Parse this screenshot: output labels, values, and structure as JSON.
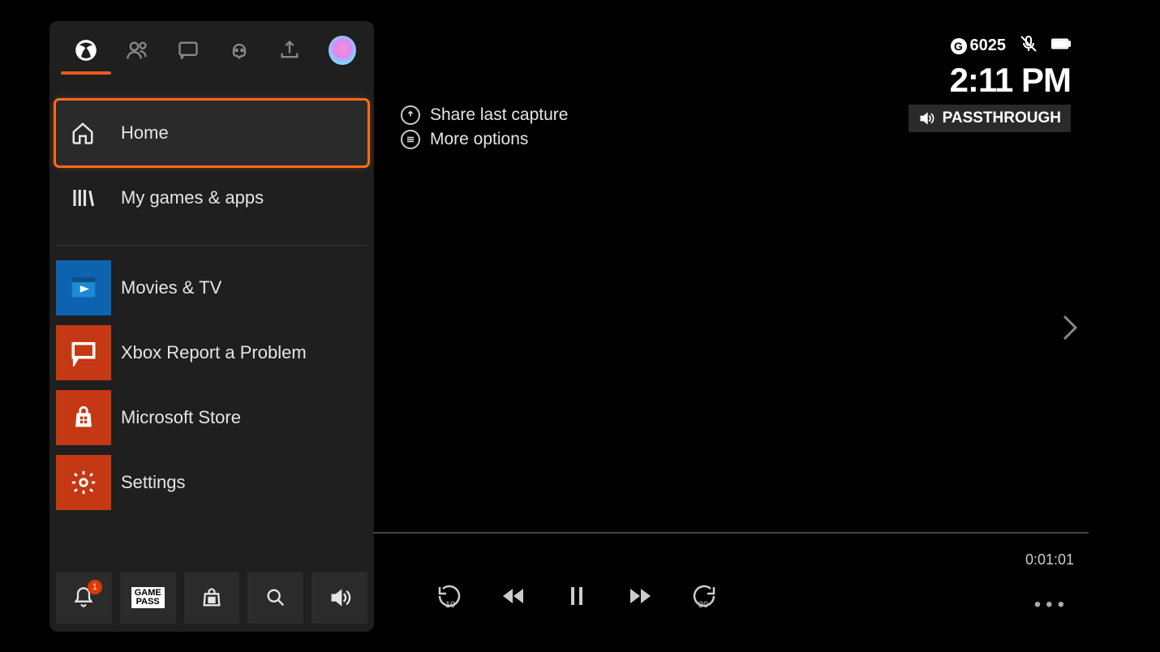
{
  "status": {
    "gamerscore": "6025",
    "clock": "2:11 PM",
    "audio_mode": "PASSTHROUGH"
  },
  "hints": {
    "share": "Share last capture",
    "more": "More options"
  },
  "guide": {
    "menu": {
      "home": "Home",
      "my_games": "My games & apps"
    },
    "apps": [
      {
        "label": "Movies & TV"
      },
      {
        "label": "Xbox Report a Problem"
      },
      {
        "label": "Microsoft Store"
      },
      {
        "label": "Settings"
      }
    ],
    "bottom": {
      "notification_badge": "1",
      "gamepass_label": "GAME\nPASS"
    }
  },
  "player": {
    "duration": "0:01:01",
    "skip_back": "10",
    "skip_fwd": "30"
  }
}
